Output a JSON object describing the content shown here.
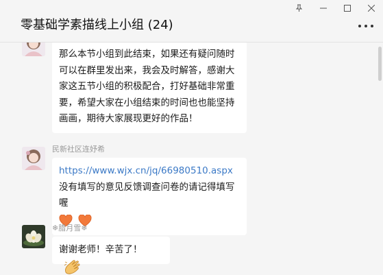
{
  "window": {
    "title": "零基础学素描线上小组 (24)",
    "controls": [
      "pin-icon",
      "minimize-icon",
      "maximize-icon",
      "close-icon"
    ]
  },
  "messages": [
    {
      "avatar": "anime-girl-avatar",
      "sender": "",
      "text": "那么本节小组到此结束，如果还有疑问随时可以在群里发出来，我会及时解答，感谢大家这五节小组的积极配合，打好基础非常重要，希望大家在小组结束的时间也也能坚持画画，期待大家展现更好的作品！"
    },
    {
      "avatar": "anime-girl-avatar",
      "sender": "民新社区连妤希",
      "link": "https://www.wjx.cn/jq/66980510.aspx",
      "text": " 没有填写的意见反馈调查问卷的请记得填写喔",
      "emojis": [
        "orange-heart-icon",
        "orange-heart-icon"
      ]
    },
    {
      "avatar": "lotus-flower-avatar",
      "sender": "❄腊月雪❄",
      "text": "谢谢老师！辛苦了！",
      "emoji": "clapping-hands-icon"
    }
  ]
}
